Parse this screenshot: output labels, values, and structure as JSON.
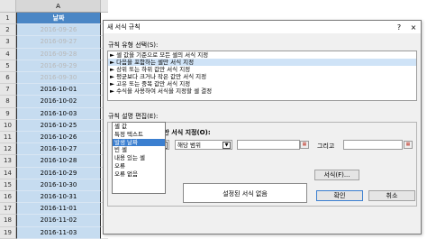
{
  "sheet": {
    "column_a": "A",
    "rows": [
      {
        "n": "1",
        "v": "날짜",
        "kind": "hdr"
      },
      {
        "n": "2",
        "v": "2016-09-26",
        "kind": "gray"
      },
      {
        "n": "3",
        "v": "2016-09-27",
        "kind": "gray"
      },
      {
        "n": "4",
        "v": "2016-09-28",
        "kind": "gray"
      },
      {
        "n": "5",
        "v": "2016-09-29",
        "kind": "gray"
      },
      {
        "n": "6",
        "v": "2016-09-30",
        "kind": "gray"
      },
      {
        "n": "7",
        "v": "2016-10-01",
        "kind": ""
      },
      {
        "n": "8",
        "v": "2016-10-02",
        "kind": ""
      },
      {
        "n": "9",
        "v": "2016-10-03",
        "kind": ""
      },
      {
        "n": "10",
        "v": "2016-10-25",
        "kind": ""
      },
      {
        "n": "11",
        "v": "2016-10-26",
        "kind": ""
      },
      {
        "n": "12",
        "v": "2016-10-27",
        "kind": ""
      },
      {
        "n": "13",
        "v": "2016-10-28",
        "kind": ""
      },
      {
        "n": "14",
        "v": "2016-10-29",
        "kind": ""
      },
      {
        "n": "15",
        "v": "2016-10-30",
        "kind": ""
      },
      {
        "n": "16",
        "v": "2016-10-31",
        "kind": ""
      },
      {
        "n": "17",
        "v": "2016-11-01",
        "kind": ""
      },
      {
        "n": "18",
        "v": "2016-11-02",
        "kind": ""
      },
      {
        "n": "19",
        "v": "2016-11-03",
        "kind": ""
      }
    ]
  },
  "dialog": {
    "title": "새 서식 규칙",
    "help": "?",
    "close": "×",
    "rule_type_label": "규칙 유형 선택(S):",
    "rule_types": [
      "► 셀 값을 기준으로 모든 셀의 서식 지정",
      "► 다음을 포함하는 셀만 서식 지정",
      "► 상위 또는 하위 값만 서식 지정",
      "► 평균보다 크거나 작은 값만 서식 지정",
      "► 고유 또는 중복 값만 서식 지정",
      "► 수식을 사용하여 서식을 지정할 셀 결정"
    ],
    "rule_desc_label": "규칙 설명 편집(E):",
    "format_only_label": "다음을 포함하는 셀만 서식 지정(O):",
    "condition_value": "셀 값",
    "operator_value": "해당 범위",
    "and_label": "그리고",
    "options": [
      "셀 값",
      "특정 텍스트",
      "발생 날짜",
      "빈 셀",
      "내용 있는 셀",
      "오류",
      "오류 없음"
    ],
    "preview_text": "설정된 서식 없음",
    "format_button": "서식(F)...",
    "ok_button": "확인",
    "cancel_button": "취소"
  }
}
